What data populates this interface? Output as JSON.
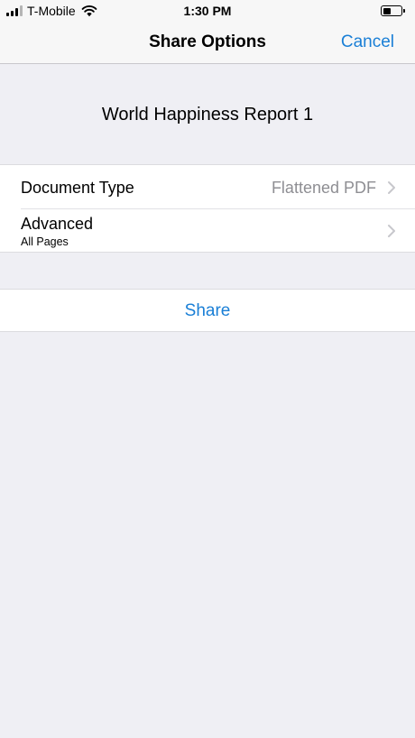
{
  "status_bar": {
    "carrier": "T-Mobile",
    "time": "1:30 PM"
  },
  "nav": {
    "title": "Share Options",
    "cancel_label": "Cancel"
  },
  "document": {
    "name": "World Happiness Report 1"
  },
  "options": {
    "document_type": {
      "label": "Document Type",
      "value": "Flattened PDF"
    },
    "advanced": {
      "label": "Advanced",
      "subtitle": "All Pages"
    }
  },
  "share": {
    "label": "Share"
  },
  "colors": {
    "accent": "#1a7fd6",
    "background": "#efeff4",
    "secondary_text": "#8e8e93"
  }
}
